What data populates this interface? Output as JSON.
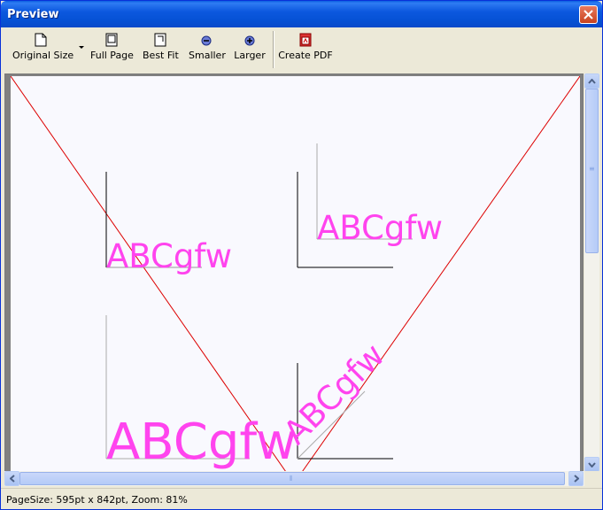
{
  "window": {
    "title": "Preview"
  },
  "toolbar": {
    "buttons": [
      {
        "label": "Original Size",
        "icon": "page-icon"
      },
      {
        "label": "Full Page",
        "icon": "full-page-icon"
      },
      {
        "label": "Best Fit",
        "icon": "best-fit-icon"
      },
      {
        "label": "Smaller",
        "icon": "zoom-out-icon"
      },
      {
        "label": "Larger",
        "icon": "zoom-in-icon"
      },
      {
        "label": "Create PDF",
        "icon": "pdf-icon"
      }
    ]
  },
  "preview": {
    "samples": [
      "ABCgfw",
      "ABCgfw",
      "ABCgfw",
      "ABCgfw"
    ],
    "text_color": "#ff44ee",
    "line_color": "#dd0000"
  },
  "status": {
    "text": "PageSize: 595pt x 842pt, Zoom: 81%"
  }
}
